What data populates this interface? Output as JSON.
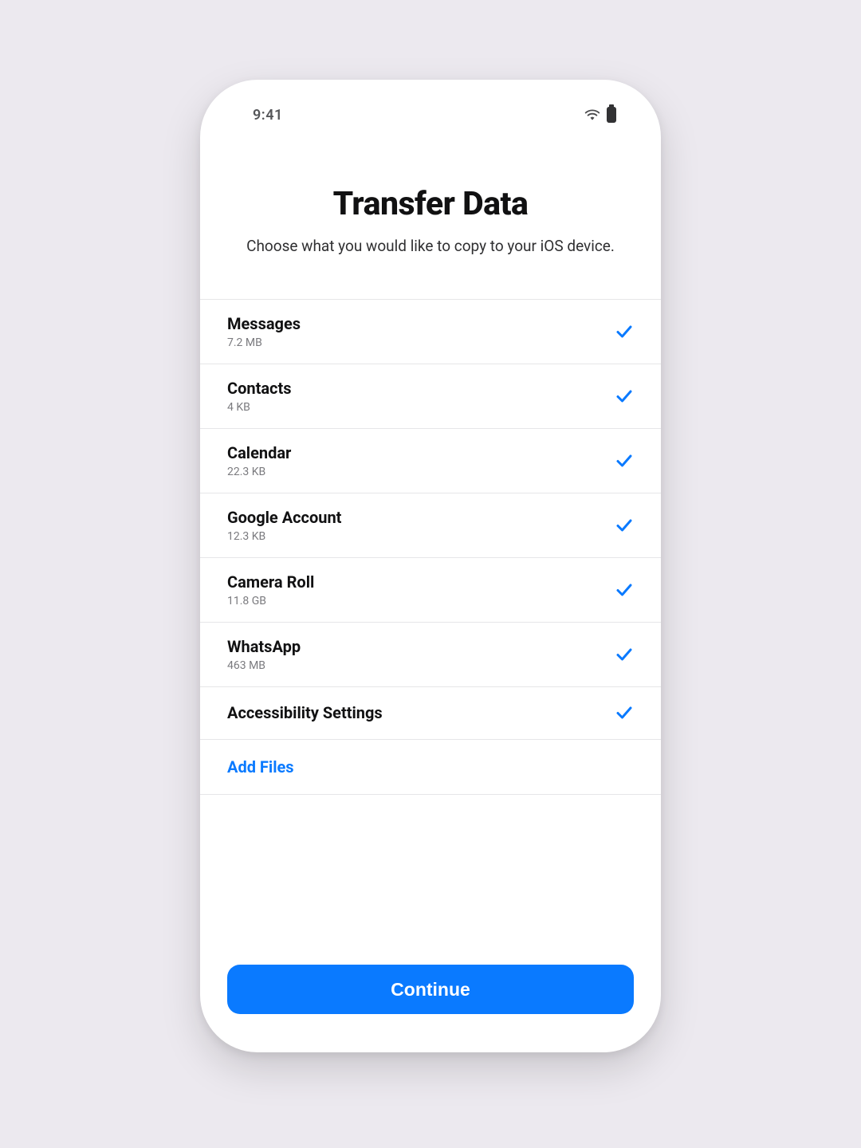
{
  "status": {
    "time": "9:41"
  },
  "header": {
    "title": "Transfer Data",
    "subtitle": "Choose what you would like to copy to your iOS device."
  },
  "items": [
    {
      "title": "Messages",
      "size": "7.2 MB",
      "checked": true
    },
    {
      "title": "Contacts",
      "size": "4 KB",
      "checked": true
    },
    {
      "title": "Calendar",
      "size": "22.3 KB",
      "checked": true
    },
    {
      "title": "Google Account",
      "size": "12.3 KB",
      "checked": true
    },
    {
      "title": "Camera Roll",
      "size": "11.8 GB",
      "checked": true
    },
    {
      "title": "WhatsApp",
      "size": "463 MB",
      "checked": true
    },
    {
      "title": "Accessibility Settings",
      "size": "",
      "checked": true
    }
  ],
  "addFiles": {
    "label": "Add Files"
  },
  "footer": {
    "continue": "Continue"
  },
  "colors": {
    "accent": "#0a7aff",
    "bg": "#ece9ef"
  }
}
